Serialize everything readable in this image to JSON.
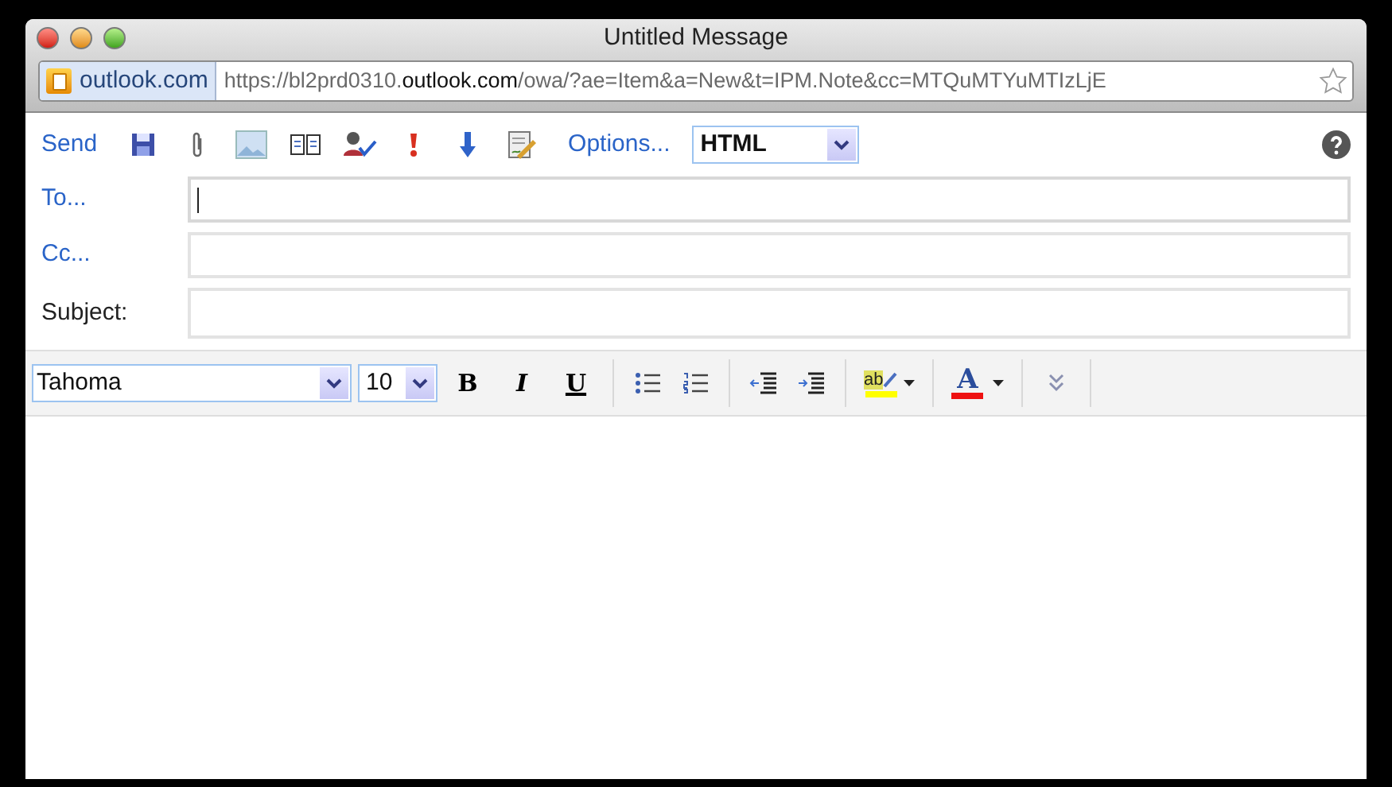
{
  "window": {
    "title": "Untitled Message"
  },
  "address_bar": {
    "site": "outlook.com",
    "url": "https://bl2prd0310.**outlook.com**/owa/?ae=Item&a=New&t=IPM.Note&cc=MTQuMTYuMTIzLjE"
  },
  "toolbar": {
    "send": "Send",
    "options": "Options...",
    "format": "HTML"
  },
  "fields": [
    {
      "label": "To...",
      "kind": "link",
      "focused": true
    },
    {
      "label": "Cc...",
      "kind": "link",
      "focused": false
    },
    {
      "label": "Subject:",
      "kind": "plain",
      "focused": false
    }
  ],
  "format_bar": {
    "font": "Tahoma",
    "size": "10",
    "bold": "B",
    "italic": "I",
    "underline": "U",
    "highlight": "ab",
    "font_color": "A"
  }
}
